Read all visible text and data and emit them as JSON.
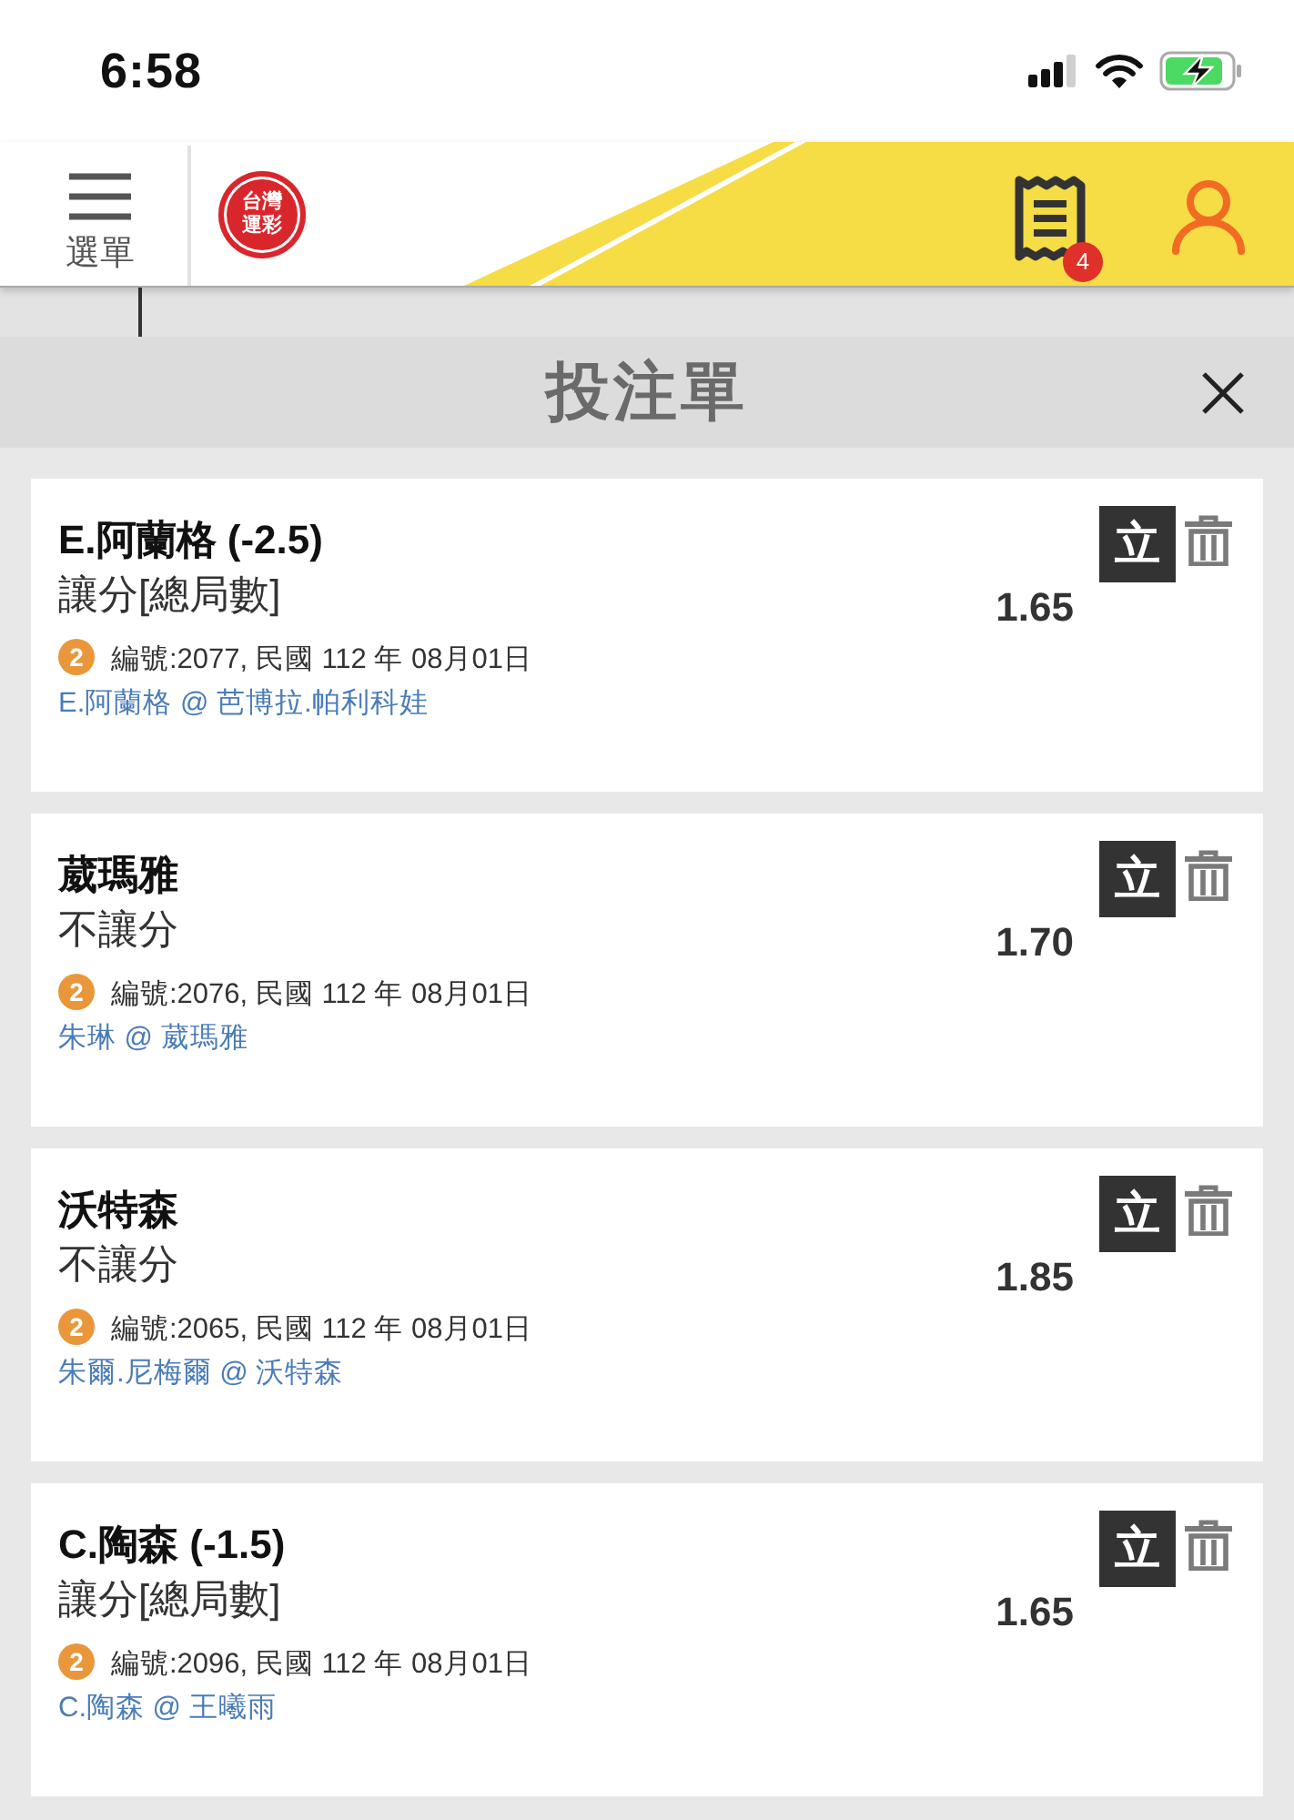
{
  "status_bar": {
    "time": "6:58"
  },
  "header": {
    "menu_label": "選單",
    "logo_text": "台灣運彩",
    "bet_count": "4"
  },
  "bet_slip": {
    "title": "投注單",
    "bets": [
      {
        "selection": "E.阿蘭格 (-2.5)",
        "market": "讓分[總局數]",
        "odds": "1.65",
        "badge": "2",
        "info": "編號:2077, 民國 112 年 08月01日",
        "matchup": "E.阿蘭格 @ 芭博拉.帕利科娃",
        "single_label": "立"
      },
      {
        "selection": "葳瑪雅",
        "market": "不讓分",
        "odds": "1.70",
        "badge": "2",
        "info": "編號:2076, 民國 112 年 08月01日",
        "matchup": "朱琳 @ 葳瑪雅",
        "single_label": "立"
      },
      {
        "selection": "沃特森",
        "market": "不讓分",
        "odds": "1.85",
        "badge": "2",
        "info": "編號:2065, 民國 112 年 08月01日",
        "matchup": "朱爾.尼梅爾 @ 沃特森",
        "single_label": "立"
      },
      {
        "selection": "C.陶森 (-1.5)",
        "market": "讓分[總局數]",
        "odds": "1.65",
        "badge": "2",
        "info": "編號:2096, 民國 112 年 08月01日",
        "matchup": "C.陶森 @ 王曦雨",
        "single_label": "立"
      }
    ]
  }
}
